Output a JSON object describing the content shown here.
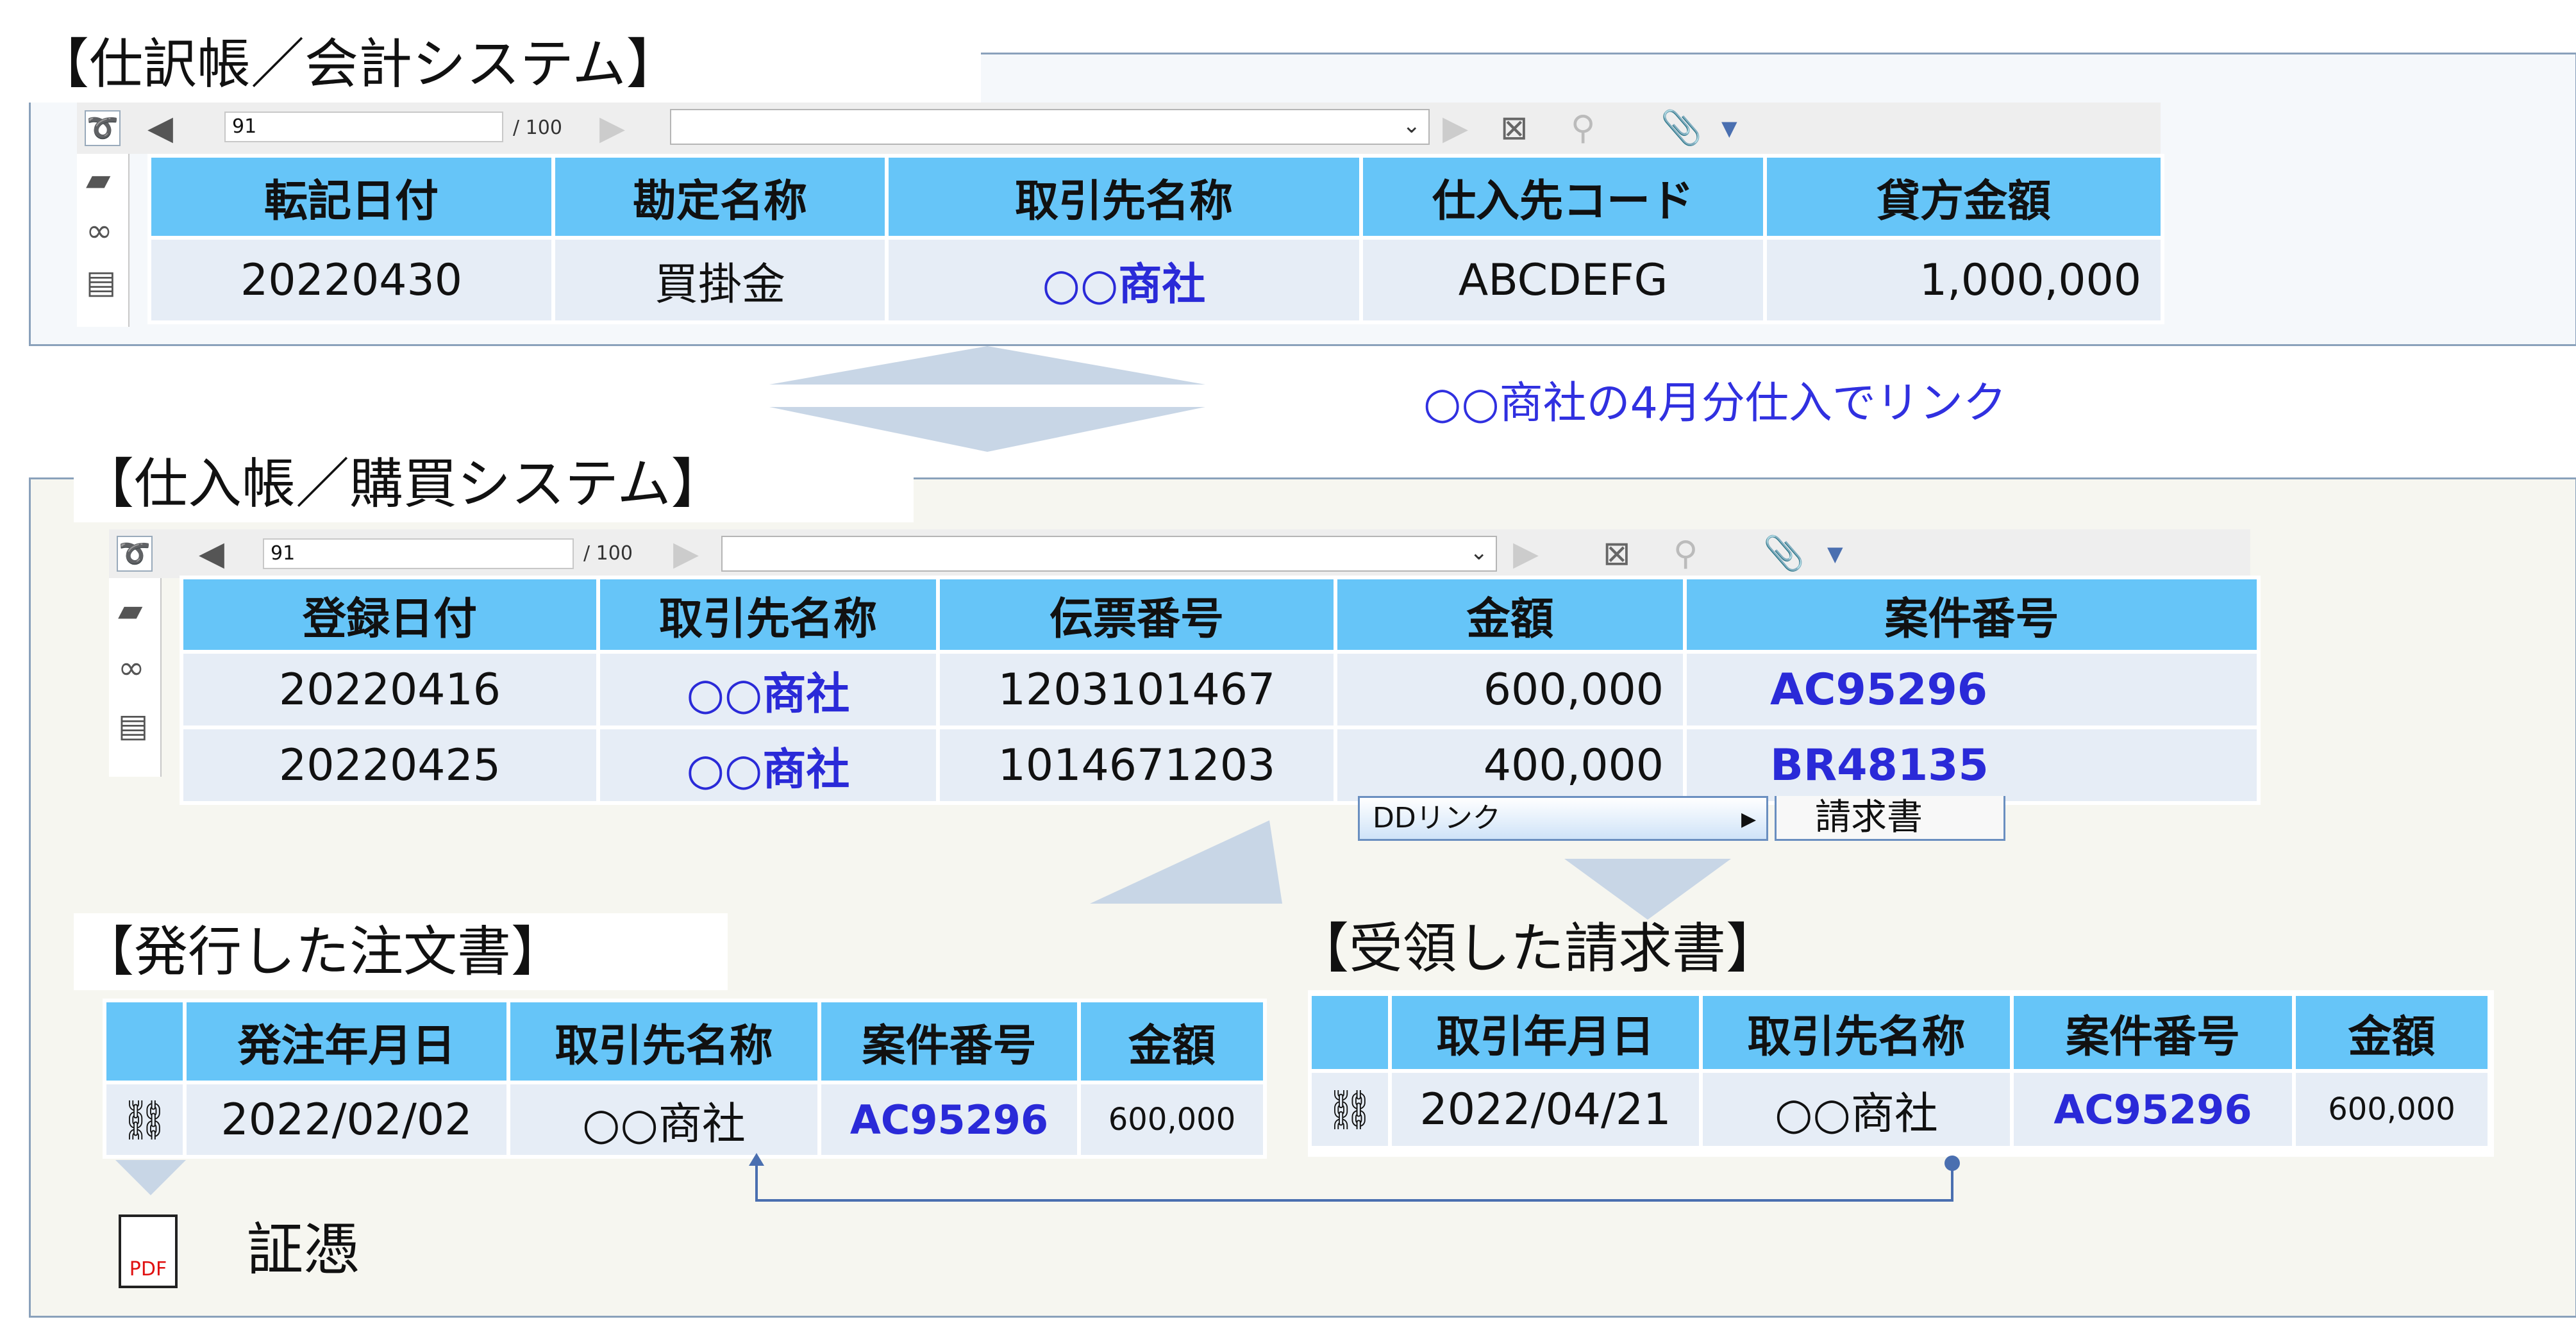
{
  "colors": {
    "header": "#66c5f8",
    "cell": "#e6edf6",
    "link": "#2a2ad8",
    "panel_border": "#8aa1bb",
    "arrow": "#c8d6e6"
  },
  "panel1": {
    "title": "【仕訳帳／会計システム】",
    "toolbar": {
      "page": "91",
      "total": "/ 100"
    },
    "table": {
      "headers": [
        "転記日付",
        "勘定名称",
        "取引先名称",
        "仕入先コード",
        "貸方金額"
      ],
      "rows": [
        [
          "20220430",
          "買掛金",
          "○○商社",
          "ABCDEFG",
          "1,000,000"
        ]
      ]
    }
  },
  "link_caption": "○○商社の4月分仕入でリンク",
  "panel2": {
    "title": "【仕入帳／購買システム】",
    "toolbar": {
      "page": "91",
      "total": "/ 100"
    },
    "table": {
      "headers": [
        "登録日付",
        "取引先名称",
        "伝票番号",
        "金額",
        "案件番号"
      ],
      "rows": [
        [
          "20220416",
          "○○商社",
          "1203101467",
          "600,000",
          "AC95296"
        ],
        [
          "20220425",
          "○○商社",
          "1014671203",
          "400,000",
          "BR48135"
        ]
      ]
    },
    "context_menu": {
      "item": "DDリンク",
      "submenu": "請求書"
    }
  },
  "purchase_order": {
    "title": "【発行した注文書】",
    "headers": [
      "",
      "発注年月日",
      "取引先名称",
      "案件番号",
      "金額"
    ],
    "rows": [
      [
        "",
        "2022/02/02",
        "○○商社",
        "AC95296",
        "600,000"
      ]
    ]
  },
  "invoice": {
    "title": "【受領した請求書】",
    "headers": [
      "",
      "取引年月日",
      "取引先名称",
      "案件番号",
      "金額"
    ],
    "rows": [
      [
        "",
        "2022/04/21",
        "○○商社",
        "AC95296",
        "600,000"
      ]
    ]
  },
  "evidence": {
    "pdf_label": "PDF",
    "label": "証憑"
  },
  "icons": [
    "app-logo-icon",
    "first-page-icon",
    "next-page-icon",
    "prev-page-icon",
    "last-page-icon",
    "clear-filter-icon",
    "link-icon",
    "attachment-icon",
    "dropdown-icon",
    "folder-icon",
    "binoculars-icon",
    "document-search-icon",
    "chain-link-icon",
    "pdf-file-icon"
  ]
}
